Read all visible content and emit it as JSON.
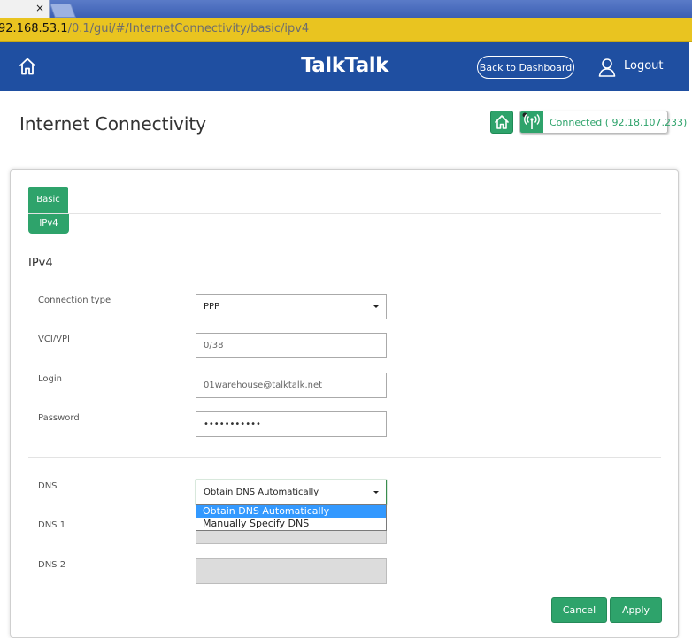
{
  "browser": {
    "tab_close": "×",
    "url_host": "92.168.53.1",
    "url_path": "/0.1/gui/#/InternetConnectivity/basic/ipv4"
  },
  "header": {
    "logo": "TalkTalk",
    "back_label": "Back to Dashboard",
    "logout_label": "Logout"
  },
  "page": {
    "title": "Internet Connectivity",
    "status_text": "Connected ( 92.18.107.233)"
  },
  "tabs": {
    "basic": "Basic",
    "ipv4": "IPv4"
  },
  "section": {
    "title": "IPv4"
  },
  "fields": {
    "connection_type": {
      "label": "Connection type",
      "value": "PPP"
    },
    "vci_vpi": {
      "label": "VCI/VPI",
      "value": "0/38"
    },
    "login": {
      "label": "Login",
      "value": "01warehouse@talktalk.net"
    },
    "password": {
      "label": "Password",
      "value": "•••••••••••"
    },
    "dns": {
      "label": "DNS",
      "value": "Obtain DNS Automatically",
      "options": [
        "Obtain DNS Automatically",
        "Manually Specify DNS"
      ],
      "highlighted_option": "Obtain DNS Automatically"
    },
    "dns1": {
      "label": "DNS 1",
      "value": ""
    },
    "dns2": {
      "label": "DNS 2",
      "value": ""
    }
  },
  "buttons": {
    "cancel": "Cancel",
    "apply": "Apply"
  },
  "colors": {
    "header_bg": "#1f4fa1",
    "accent_green": "#2ea36b",
    "url_bar": "#e9c420",
    "dropdown_highlight": "#3399ff"
  }
}
